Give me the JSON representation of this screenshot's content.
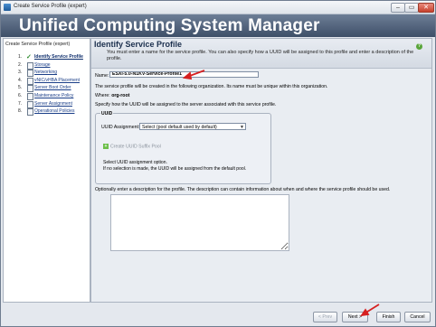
{
  "window": {
    "title": "Create Service Profile (expert)"
  },
  "header": {
    "title": "Unified Computing System Manager"
  },
  "left_pane": {
    "title": "Create Service Profile (expert)",
    "steps": [
      {
        "num": "1.",
        "label": "Identify Service Profile"
      },
      {
        "num": "2.",
        "label": "Storage"
      },
      {
        "num": "3.",
        "label": "Networking"
      },
      {
        "num": "4.",
        "label": "vNIC/vHBA Placement"
      },
      {
        "num": "5.",
        "label": "Server Boot Order"
      },
      {
        "num": "6.",
        "label": "Maintenance Policy"
      },
      {
        "num": "7.",
        "label": "Server Assignment"
      },
      {
        "num": "8.",
        "label": "Operational Policies"
      }
    ]
  },
  "main": {
    "title": "Identify Service Profile",
    "description": "You must enter a name for the service profile. You can also specify how a UUID will be assigned to this profile and enter a description of the profile.",
    "name_label": "Name:",
    "name_value": "ESXi-5.0-N1KV-Service-Profile1",
    "info_org": "The service profile will be created in the following organization. Its name must be unique within this organization.",
    "where_label": "Where:",
    "where_value": "org-root",
    "info_uuid": "Specify how the UUID will be assigned to the server associated with this service profile.",
    "uuid": {
      "legend": "UUID",
      "assignment_label": "UUID Assignment:",
      "assignment_value": "Select (pool default used by default)",
      "create_pool": "Create UUID Suffix Pool",
      "note1": "Select UUID assignment option.",
      "note2": "If no selection is made, the UUID will be assigned from the default pool."
    },
    "desc_label": "Optionally enter a description for the profile. The description can contain information about when and where the service profile should be used."
  },
  "buttons": {
    "prev": "< Prev",
    "next": "Next >",
    "finish": "Finish",
    "cancel": "Cancel"
  },
  "colors": {
    "header": "#4f607a",
    "link": "#1a3e88",
    "annotation_arrow": "#d62020"
  }
}
